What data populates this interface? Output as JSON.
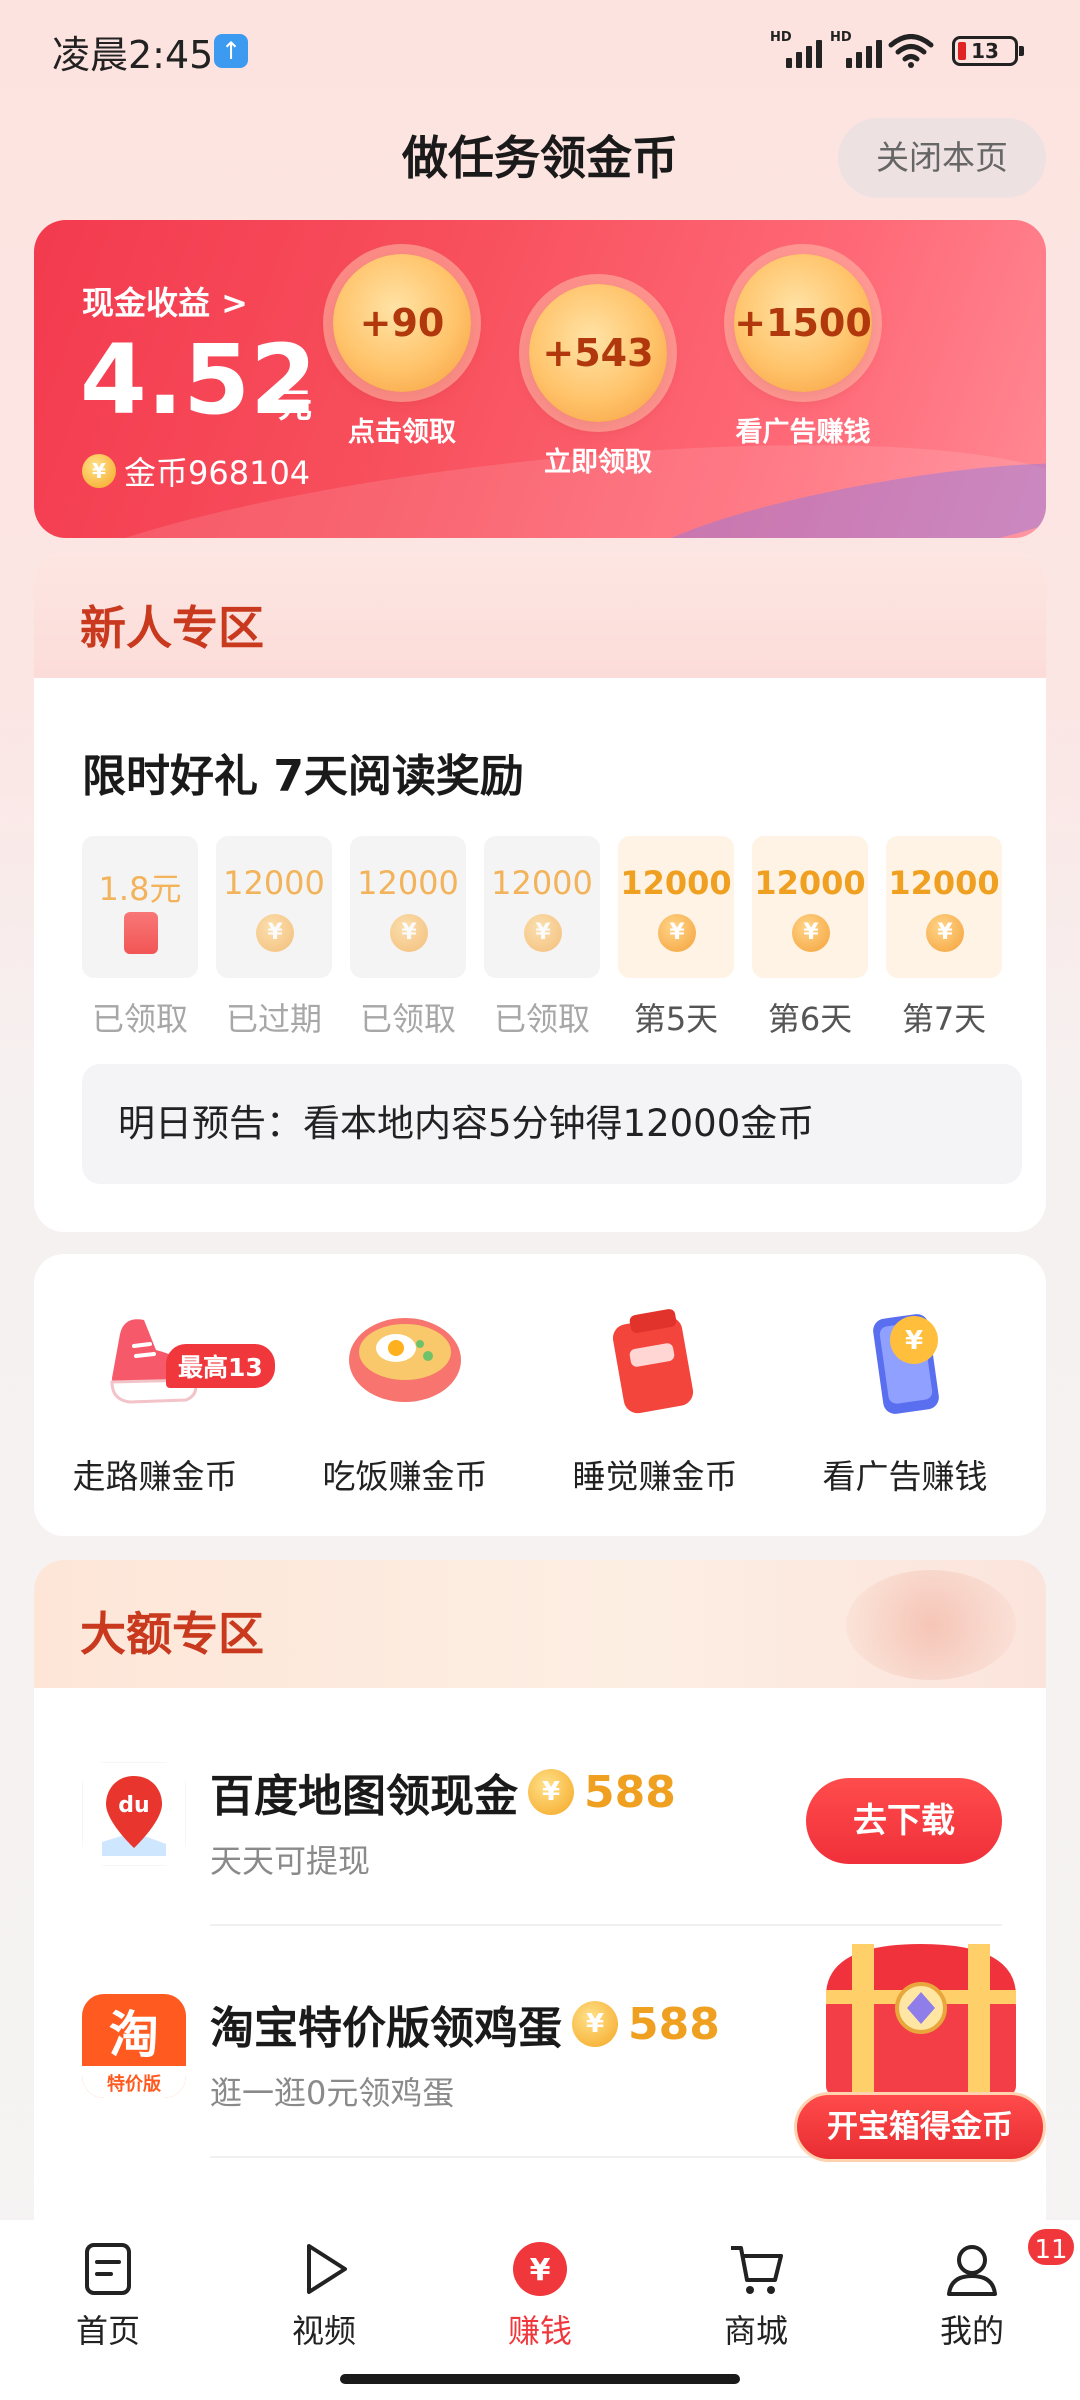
{
  "status_bar": {
    "time": "凌晨2:45",
    "signal_label_1": "HD",
    "signal_label_2": "HD",
    "battery": "13"
  },
  "header": {
    "title": "做任务领金币",
    "close_label": "关闭本页"
  },
  "earnings": {
    "cash_label": "现金收益 >",
    "cash_value": "4.52",
    "cash_unit": "元",
    "coins_label": "金币968104",
    "rewards": [
      {
        "amount": "+90",
        "label": "点击领取"
      },
      {
        "amount": "+543",
        "label": "立即领取"
      },
      {
        "amount": "+1500",
        "label": "看广告赚钱"
      }
    ]
  },
  "newbie": {
    "title": "新人专区",
    "subtitle": "限时好礼 7天阅读奖励",
    "days": [
      {
        "amount": "1.8元",
        "label": "已领取",
        "icon": "red-envelope-icon"
      },
      {
        "amount": "12000",
        "label": "已过期",
        "icon": "coin-icon"
      },
      {
        "amount": "12000",
        "label": "已领取",
        "icon": "coin-icon"
      },
      {
        "amount": "12000",
        "label": "已领取",
        "icon": "coin-icon"
      },
      {
        "amount": "12000",
        "label": "第5天",
        "icon": "coin-icon"
      },
      {
        "amount": "12000",
        "label": "第6天",
        "icon": "coin-icon"
      },
      {
        "amount": "12000",
        "label": "第7天",
        "icon": "coin-icon"
      }
    ],
    "notice": "明日预告：看本地内容5分钟得12000金币"
  },
  "quick_tasks": [
    {
      "label": "走路赚金币",
      "badge": "最高13",
      "icon": "sneaker-icon"
    },
    {
      "label": "吃饭赚金币",
      "icon": "noodle-bowl-icon"
    },
    {
      "label": "睡觉赚金币",
      "icon": "alarm-clock-icon"
    },
    {
      "label": "看广告赚钱",
      "icon": "phone-coin-icon"
    }
  ],
  "big_zone": {
    "title": "大额专区",
    "tasks": [
      {
        "name": "百度地图领现金",
        "reward": "588",
        "desc": "天天可提现",
        "button": "去下载",
        "icon_text": "du"
      },
      {
        "name": "淘宝特价版领鸡蛋",
        "reward": "588",
        "desc": "逛一逛0元领鸡蛋",
        "icon_text": "淘",
        "icon_subtext": "特价版"
      }
    ]
  },
  "treasure": {
    "label": "开宝箱得金币"
  },
  "tabbar": {
    "tabs": [
      {
        "label": "首页"
      },
      {
        "label": "视频"
      },
      {
        "label": "赚钱"
      },
      {
        "label": "商城"
      },
      {
        "label": "我的",
        "badge": "11"
      }
    ]
  },
  "colors": {
    "accent_red": "#f0373c",
    "coin_orange": "#f0a020",
    "section_title": "#c8391e"
  }
}
